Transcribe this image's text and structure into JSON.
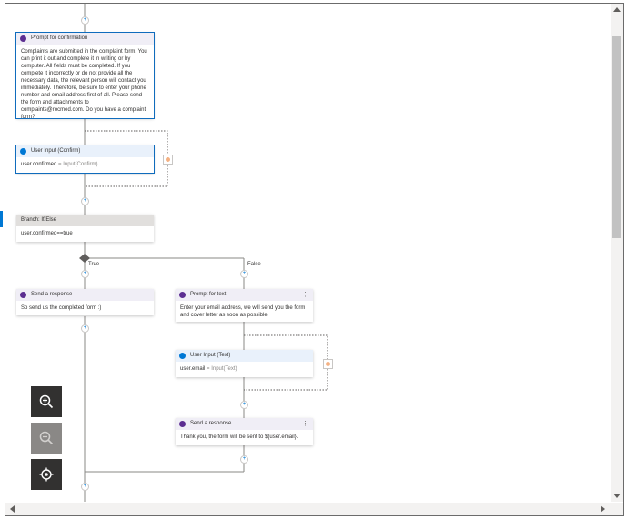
{
  "nodes": {
    "prompt_confirm": {
      "title": "Prompt for confirmation",
      "body": " Complaints are submitted in the complaint form. You can print it out and complete it in writing or by computer. All fields must be completed. If you complete it incorrectly or do not provide all the necessary data, the relevant person will contact you immediately. Therefore, be sure to enter your phone number and email address first of all. Please send the form and attachments to complaints@rocmed.com. Do you have a complaint form?"
    },
    "user_input_confirm": {
      "title": "User Input (Confirm)",
      "var": "user.confirmed",
      "expr": " = Input(Confirm)"
    },
    "branch": {
      "title": "Branch: If/Else",
      "condition": "user.confirmed==true",
      "true_label": "True",
      "false_label": "False"
    },
    "send_response_1": {
      "title": "Send a response",
      "body": "So send us the completed form :)"
    },
    "prompt_text": {
      "title": "Prompt for text",
      "body": "Enter your email address, we will send you the form and cover letter as soon as possible."
    },
    "user_input_text": {
      "title": "User Input (Text)",
      "var": "user.email",
      "expr": " = Input(Text)"
    },
    "send_response_2": {
      "title": "Send a response",
      "body": "Thank you, the form will be sent to ${user.email}."
    }
  },
  "menu_glyph": "⋮",
  "plus_glyph": "+",
  "icons": {
    "zoom_in": "zoom-in-icon",
    "zoom_out": "zoom-out-icon",
    "recenter": "recenter-icon"
  },
  "colors": {
    "accent": "#0078d4",
    "dialog_purple": "#5c2e91",
    "error_marker": "#f4b183",
    "edge": "#8a8886"
  }
}
